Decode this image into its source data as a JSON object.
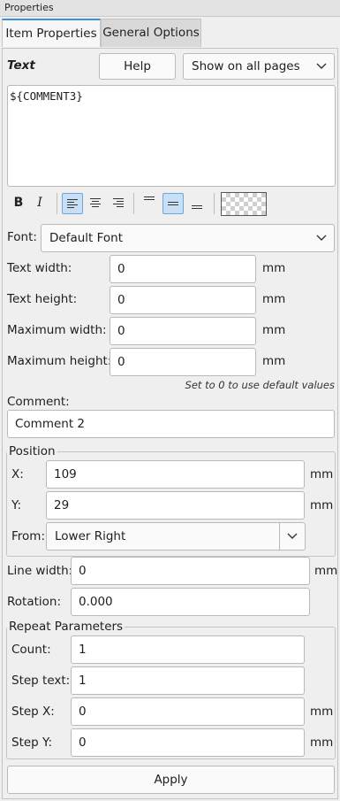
{
  "window": {
    "title": "Properties"
  },
  "tabs": [
    {
      "label": "Item Properties",
      "active": true
    },
    {
      "label": "General Options",
      "active": false
    }
  ],
  "text_section": {
    "label": "Text",
    "help_button": "Help",
    "pages_select": {
      "selected": "Show on all pages"
    },
    "text_value": "${COMMENT3}"
  },
  "toolbar": {
    "bold": "B",
    "italic": "I",
    "halign": {
      "selected": "left"
    },
    "valign": {
      "selected": "center"
    },
    "color": "transparent"
  },
  "font": {
    "label": "Font:",
    "selected": "Default Font"
  },
  "dimensions": [
    {
      "label": "Text width:",
      "value": "0",
      "unit": "mm"
    },
    {
      "label": "Text height:",
      "value": "0",
      "unit": "mm"
    },
    {
      "label": "Maximum width:",
      "value": "0",
      "unit": "mm"
    },
    {
      "label": "Maximum height:",
      "value": "0",
      "unit": "mm"
    }
  ],
  "hint": "Set to 0 to use default values",
  "comment": {
    "label": "Comment:",
    "value": "Comment 2"
  },
  "position": {
    "title": "Position",
    "x": {
      "label": "X:",
      "value": "109",
      "unit": "mm"
    },
    "y": {
      "label": "Y:",
      "value": "29",
      "unit": "mm"
    },
    "from": {
      "label": "From:",
      "selected": "Lower Right"
    }
  },
  "line_width": {
    "label": "Line width:",
    "value": "0",
    "unit": "mm"
  },
  "rotation": {
    "label": "Rotation:",
    "value": "0.000"
  },
  "repeat": {
    "title": "Repeat Parameters",
    "count": {
      "label": "Count:",
      "value": "1"
    },
    "step_text": {
      "label": "Step text:",
      "value": "1"
    },
    "step_x": {
      "label": "Step X:",
      "value": "0",
      "unit": "mm"
    },
    "step_y": {
      "label": "Step Y:",
      "value": "0",
      "unit": "mm"
    }
  },
  "apply_button": "Apply"
}
